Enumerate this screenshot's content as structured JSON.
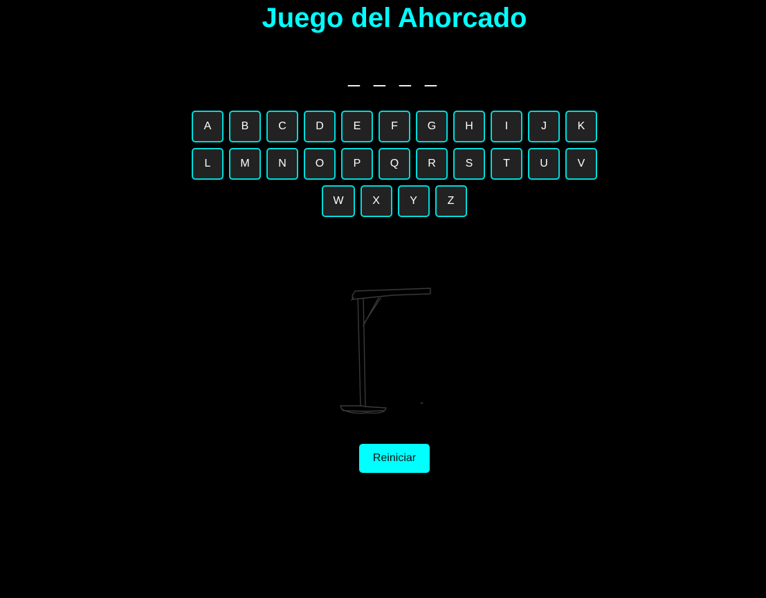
{
  "title": "Juego del Ahorcado",
  "word_display": "_ _ _ _",
  "keyboard": {
    "rows": [
      [
        "A",
        "B",
        "C",
        "D",
        "E",
        "F",
        "G",
        "H",
        "I",
        "J",
        "K"
      ],
      [
        "L",
        "M",
        "N",
        "O",
        "P",
        "Q",
        "R",
        "S",
        "T",
        "U",
        "V"
      ],
      [
        "W",
        "X",
        "Y",
        "Z"
      ]
    ]
  },
  "hangman_image": {
    "icon": "gallows-drawing",
    "stage": 0
  },
  "restart_label": "Reiniciar",
  "colors": {
    "background": "#000000",
    "accent": "#00ffff",
    "key_background": "#222222",
    "key_border": "#00dcdc",
    "text": "#ffffff"
  }
}
